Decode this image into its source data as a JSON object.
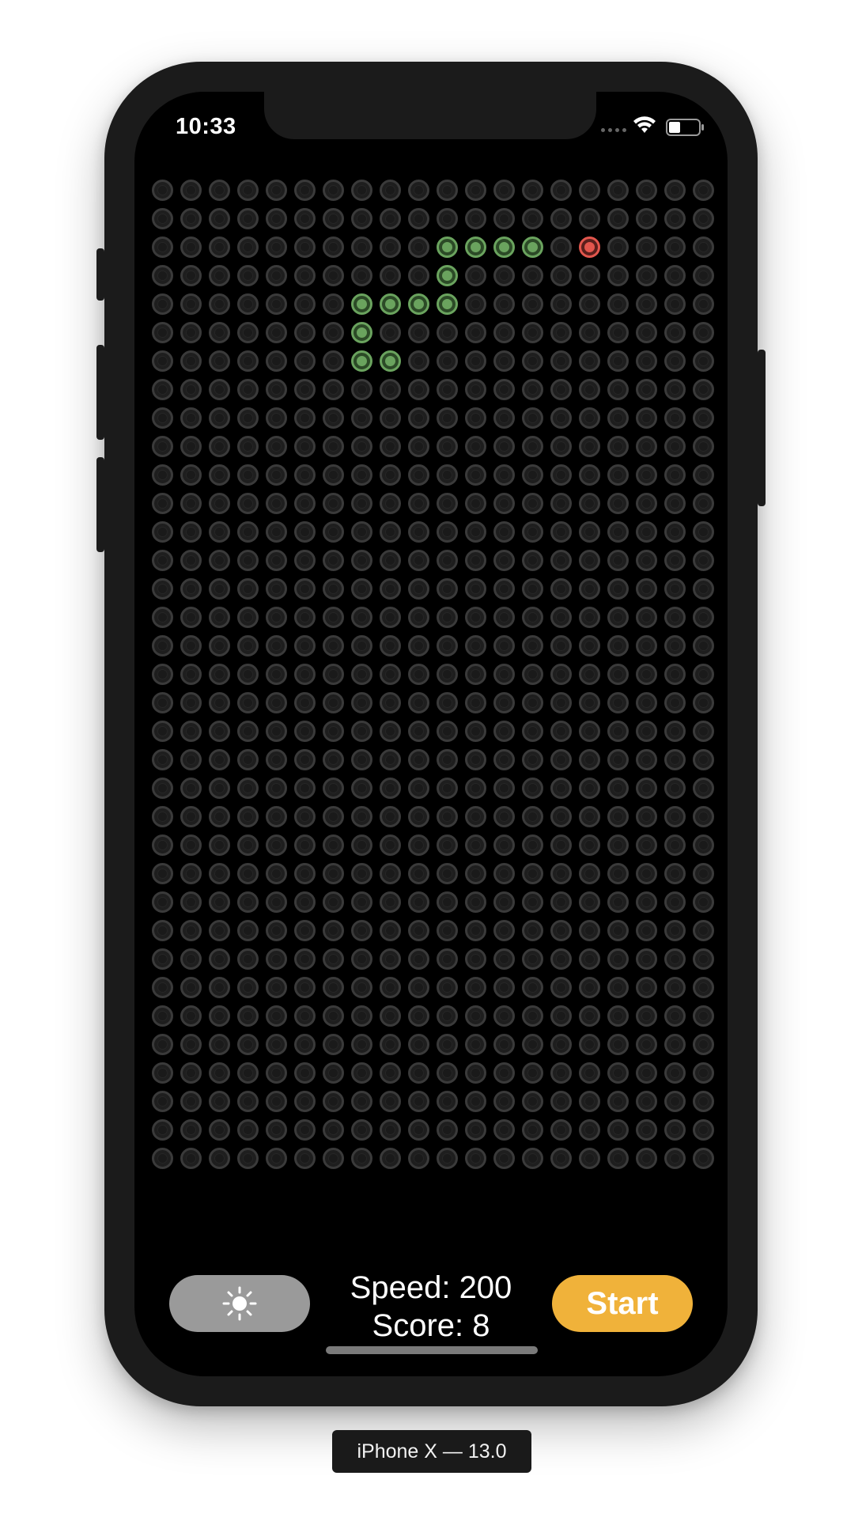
{
  "status_bar": {
    "time": "10:33",
    "wifi_icon": "wifi-icon",
    "battery_icon": "battery-icon"
  },
  "board": {
    "columns": 20,
    "rows": 35,
    "snake_cells": [
      [
        2,
        10
      ],
      [
        2,
        11
      ],
      [
        2,
        12
      ],
      [
        2,
        13
      ],
      [
        3,
        10
      ],
      [
        4,
        7
      ],
      [
        4,
        8
      ],
      [
        4,
        9
      ],
      [
        4,
        10
      ],
      [
        5,
        7
      ],
      [
        6,
        7
      ],
      [
        6,
        8
      ]
    ],
    "food_cells": [
      [
        2,
        15
      ]
    ],
    "colors": {
      "snake": "#6aa35e",
      "food": "#e2564d",
      "empty": "#3a3a3a"
    }
  },
  "controls": {
    "theme_icon": "sun-icon",
    "speed_text": "Speed: 200",
    "score_text": "Score: 8",
    "start_label": "Start",
    "start_color": "#f0b23a"
  },
  "device_label": "iPhone X — 13.0"
}
